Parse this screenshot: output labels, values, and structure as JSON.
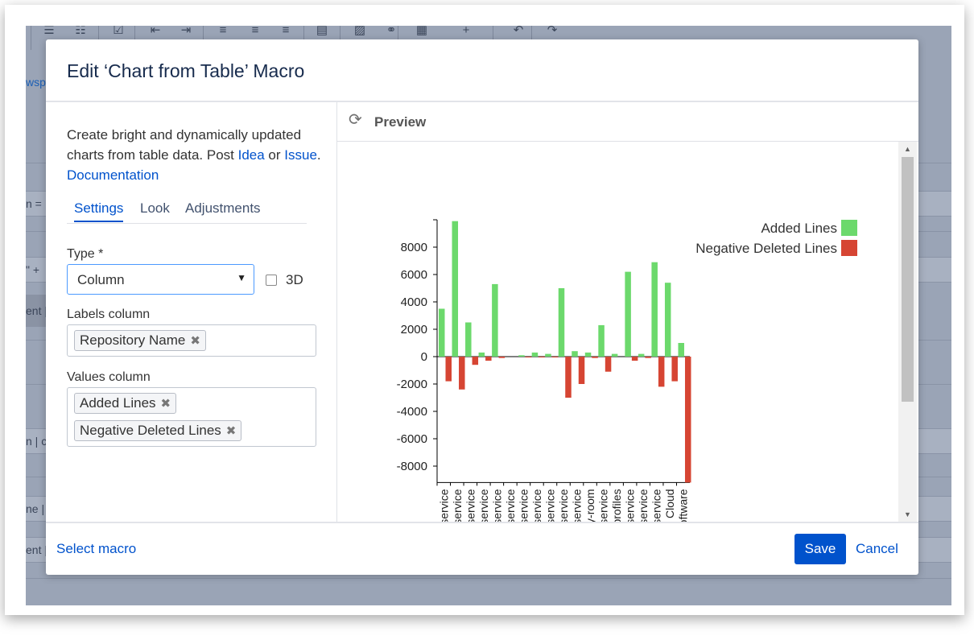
{
  "editor": {
    "fragments": [
      "wspa",
      "n =",
      "\" +",
      "ent |",
      "n | cc",
      "ne | n",
      "ent |"
    ]
  },
  "toolbar_icons": [
    "bullet-list-icon",
    "numbered-list-icon",
    "task-icon",
    "outdent-icon",
    "indent-icon",
    "align-left-icon",
    "align-center-icon",
    "align-right-icon",
    "layout-icon",
    "image-icon",
    "link-icon",
    "table-icon",
    "insert-plus-icon",
    "undo-icon",
    "redo-icon"
  ],
  "modal": {
    "title": "Edit ‘Chart from Table’ Macro",
    "description_text": "Create bright and dynamically updated charts from table data. Post ",
    "idea_link": "Idea",
    "or_text": " or ",
    "issue_link": "Issue",
    "dot_text": ". ",
    "documentation_link": "Documentation",
    "tabs": [
      "Settings",
      "Look",
      "Adjustments"
    ],
    "type_label": "Type *",
    "type_value": "Column",
    "three_d_label": "3D",
    "labels_column_label": "Labels column",
    "labels_column_tags": [
      "Repository Name"
    ],
    "values_column_label": "Values column",
    "values_column_tags": [
      "Added Lines",
      "Negative Deleted Lines"
    ],
    "preview_title": "Preview",
    "select_macro": "Select macro",
    "save": "Save",
    "cancel": "Cancel"
  },
  "chart_data": {
    "type": "bar",
    "categories": [
      "orm-service",
      "oom-service",
      "ling-service",
      "ning-service",
      "ager-service",
      "tact-service",
      "oms-service",
      "info-service",
      "info-service",
      "ogin-service",
      "tion-service",
      "mpty-room",
      "-up-service",
      "ser-profiles",
      "oom-service",
      "user-service",
      "oms-service",
      "ervice Cloud",
      "tel-software"
    ],
    "series": [
      {
        "name": "Added Lines",
        "color": "#6cd96c",
        "values": [
          3500,
          9900,
          2500,
          300,
          5300,
          0,
          100,
          300,
          200,
          5000,
          400,
          300,
          2300,
          200,
          6200,
          200,
          6900,
          5400,
          1000
        ]
      },
      {
        "name": "Negative Deleted Lines",
        "color": "#d64533",
        "values": [
          -1800,
          -2400,
          -600,
          -300,
          -100,
          0,
          -50,
          -50,
          -50,
          -3000,
          -2000,
          -100,
          -1100,
          0,
          -300,
          -100,
          -2200,
          -1800,
          -9200
        ]
      }
    ],
    "yticks": [
      8000,
      6000,
      4000,
      2000,
      0,
      -2000,
      -4000,
      -6000,
      -8000
    ],
    "ylim": [
      -9200,
      10000
    ],
    "legend_position": "top-right",
    "grid": false
  }
}
